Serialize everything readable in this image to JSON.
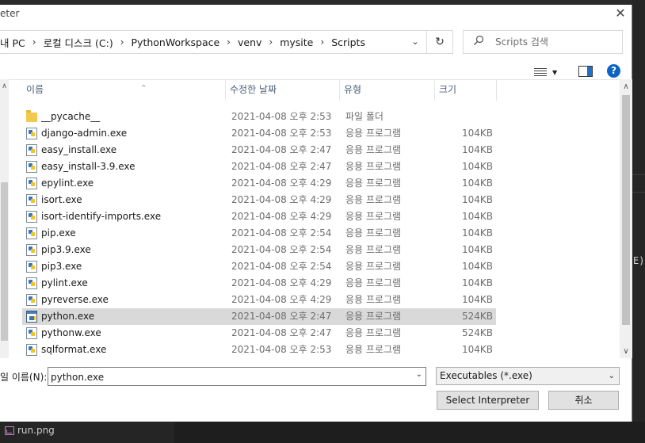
{
  "dialog": {
    "title": "eter",
    "close_glyph": "✕"
  },
  "addressbar": {
    "crumbs": [
      "내 PC",
      "로컬 디스크 (C:)",
      "PythonWorkspace",
      "venv",
      "mysite",
      "Scripts"
    ],
    "separator": "›",
    "dropdown_glyph": "⌄",
    "refresh_glyph": "↻"
  },
  "search": {
    "placeholder": "Scripts 검색",
    "icon": "search-icon"
  },
  "toolbar": {
    "view_icon": "details-view-icon",
    "preview_icon": "preview-pane-icon",
    "help_label": "?"
  },
  "columns": [
    "이름",
    "수정한 날짜",
    "유형",
    "크기"
  ],
  "files": [
    {
      "name": "__pycache__",
      "date": "2021-04-08 오후 2:53",
      "type": "파일 폴더",
      "size": "",
      "icon": "folder-icon",
      "selected": false
    },
    {
      "name": "django-admin.exe",
      "date": "2021-04-08 오후 2:53",
      "type": "응용 프로그램",
      "size": "104KB",
      "icon": "python-exe-icon",
      "selected": false
    },
    {
      "name": "easy_install.exe",
      "date": "2021-04-08 오후 2:47",
      "type": "응용 프로그램",
      "size": "104KB",
      "icon": "python-exe-icon",
      "selected": false
    },
    {
      "name": "easy_install-3.9.exe",
      "date": "2021-04-08 오후 2:47",
      "type": "응용 프로그램",
      "size": "104KB",
      "icon": "python-exe-icon",
      "selected": false
    },
    {
      "name": "epylint.exe",
      "date": "2021-04-08 오후 4:29",
      "type": "응용 프로그램",
      "size": "104KB",
      "icon": "python-exe-icon",
      "selected": false
    },
    {
      "name": "isort.exe",
      "date": "2021-04-08 오후 4:29",
      "type": "응용 프로그램",
      "size": "104KB",
      "icon": "python-exe-icon",
      "selected": false
    },
    {
      "name": "isort-identify-imports.exe",
      "date": "2021-04-08 오후 4:29",
      "type": "응용 프로그램",
      "size": "104KB",
      "icon": "python-exe-icon",
      "selected": false
    },
    {
      "name": "pip.exe",
      "date": "2021-04-08 오후 2:54",
      "type": "응용 프로그램",
      "size": "104KB",
      "icon": "python-exe-icon",
      "selected": false
    },
    {
      "name": "pip3.9.exe",
      "date": "2021-04-08 오후 2:54",
      "type": "응용 프로그램",
      "size": "104KB",
      "icon": "python-exe-icon",
      "selected": false
    },
    {
      "name": "pip3.exe",
      "date": "2021-04-08 오후 2:54",
      "type": "응용 프로그램",
      "size": "104KB",
      "icon": "python-exe-icon",
      "selected": false
    },
    {
      "name": "pylint.exe",
      "date": "2021-04-08 오후 4:29",
      "type": "응용 프로그램",
      "size": "104KB",
      "icon": "python-exe-icon",
      "selected": false
    },
    {
      "name": "pyreverse.exe",
      "date": "2021-04-08 오후 4:29",
      "type": "응용 프로그램",
      "size": "104KB",
      "icon": "python-exe-icon",
      "selected": false
    },
    {
      "name": "python.exe",
      "date": "2021-04-08 오후 2:47",
      "type": "응용 프로그램",
      "size": "524KB",
      "icon": "python-console-icon",
      "selected": true
    },
    {
      "name": "pythonw.exe",
      "date": "2021-04-08 오후 2:47",
      "type": "응용 프로그램",
      "size": "524KB",
      "icon": "python-window-icon",
      "selected": false
    },
    {
      "name": "sqlformat.exe",
      "date": "2021-04-08 오후 2:53",
      "type": "응용 프로그램",
      "size": "104KB",
      "icon": "python-exe-icon",
      "selected": false
    }
  ],
  "filename": {
    "label": "일 이름(N):",
    "value": "python.exe"
  },
  "filetype": {
    "selected": "Executables (*.exe)"
  },
  "buttons": {
    "ok": "Select Interpreter",
    "cancel": "취소"
  },
  "background": {
    "editor_fragment": "E)",
    "taskbar_file": "run.png"
  },
  "colors": {
    "selection": "#d9d9d9",
    "header_text": "#4c607a",
    "accent": "#0b63c4"
  }
}
